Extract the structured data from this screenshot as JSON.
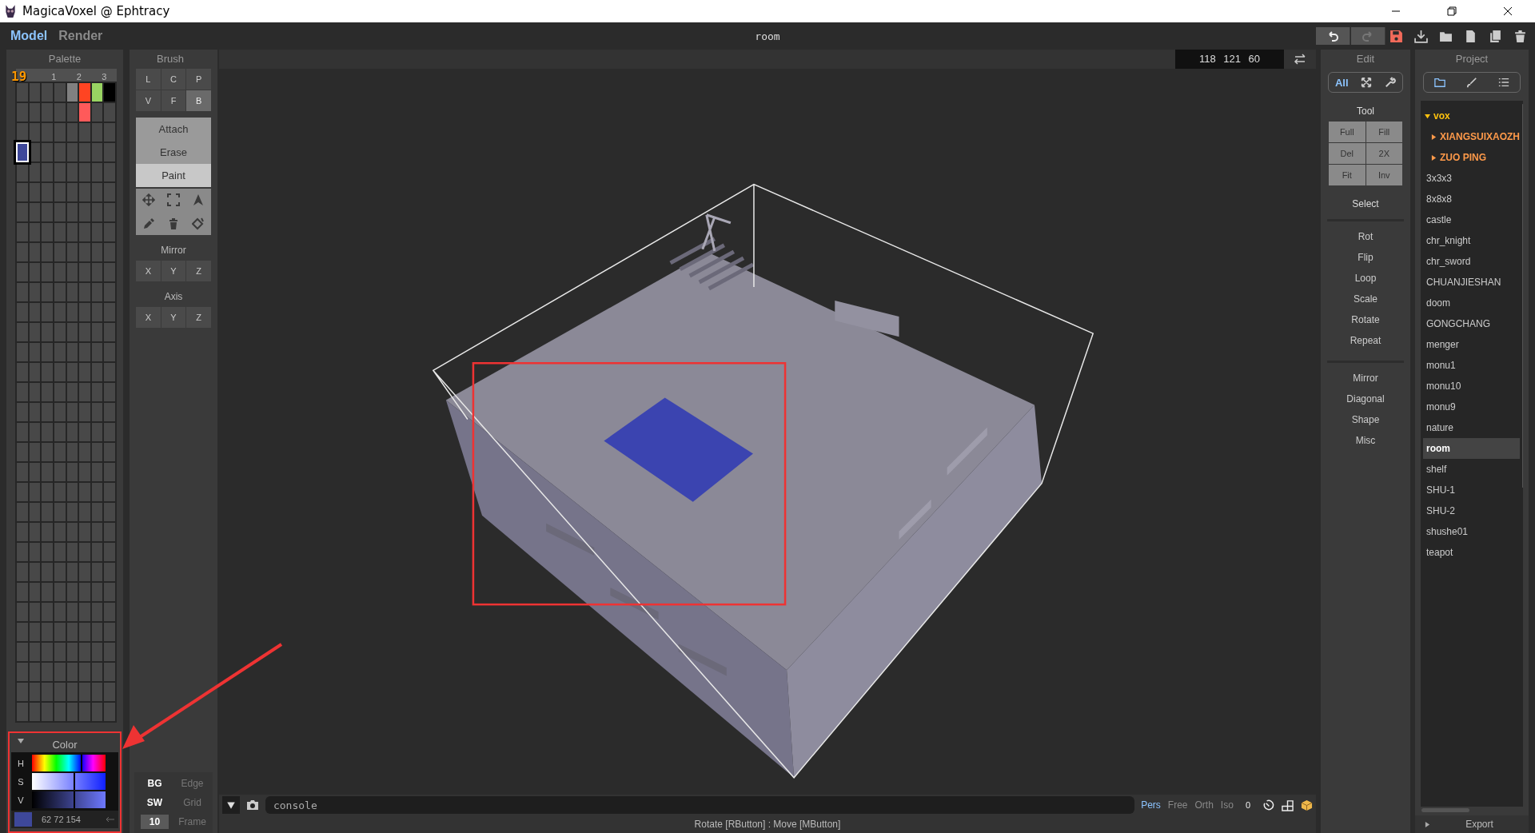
{
  "window": {
    "title": "MagicaVoxel @ Ephtracy"
  },
  "modes": [
    {
      "label": "Model",
      "selected": true
    },
    {
      "label": "Render",
      "selected": false
    }
  ],
  "file_name": "room",
  "toolbar": [
    {
      "kind": "undo",
      "disabled": false
    },
    {
      "kind": "redo",
      "disabled": true
    },
    {
      "kind": "save",
      "disabled": false
    },
    {
      "kind": "export",
      "disabled": false
    },
    {
      "kind": "open",
      "disabled": false
    },
    {
      "kind": "new",
      "disabled": false
    },
    {
      "kind": "copy",
      "disabled": false
    },
    {
      "kind": "delete",
      "disabled": false
    }
  ],
  "palette": {
    "title": "Palette",
    "index_label": "19",
    "column_headers": [
      "1",
      "2",
      "3"
    ],
    "swatches": [
      {
        "color": "#808080",
        "selected": false
      },
      {
        "color": "#ff4422",
        "selected": false
      },
      {
        "color": "#99d462",
        "selected": false
      },
      {
        "color": "#000000",
        "selected": false
      },
      {
        "color": "#ff5a5a",
        "selected": false
      },
      {
        "color": "#3e489a",
        "selected": true
      }
    ]
  },
  "color": {
    "title": "Color",
    "expanded": true,
    "channels": [
      {
        "label": "H",
        "level": 0.66
      },
      {
        "label": "S",
        "level": 0.56
      },
      {
        "label": "V",
        "level": 0.56
      }
    ],
    "color": "#3e489a",
    "rgb": "62 72 154"
  },
  "brush": {
    "title": "Brush",
    "shapes": [
      {
        "label": "L",
        "selected": false
      },
      {
        "label": "C",
        "selected": false
      },
      {
        "label": "P",
        "selected": false
      },
      {
        "label": "V",
        "selected": false
      },
      {
        "label": "F",
        "selected": false
      },
      {
        "label": "B",
        "selected": true
      }
    ],
    "actions": [
      {
        "label": "Attach",
        "selected": false
      },
      {
        "label": "Erase",
        "selected": false
      },
      {
        "label": "Paint",
        "selected": true
      }
    ],
    "tools": [
      {
        "kind": "move"
      },
      {
        "kind": "box"
      },
      {
        "kind": "cursor"
      },
      {
        "kind": "picker"
      },
      {
        "kind": "trash"
      },
      {
        "kind": "bucket"
      }
    ],
    "mirror": {
      "title": "Mirror",
      "axes": [
        "X",
        "Y",
        "Z"
      ]
    },
    "axis": {
      "title": "Axis",
      "axes": [
        "X",
        "Y",
        "Z"
      ]
    },
    "display": [
      {
        "kind": "toggle",
        "label": "BG",
        "on": true
      },
      {
        "kind": "toggle",
        "label": "Edge",
        "on": false
      },
      {
        "kind": "toggle",
        "label": "SW",
        "on": true
      },
      {
        "kind": "toggle",
        "label": "Grid",
        "on": false
      },
      {
        "kind": "field",
        "value": "10"
      },
      {
        "kind": "toggle",
        "label": "Frame",
        "on": false
      }
    ]
  },
  "viewport": {
    "coordinates": "118 121 60",
    "console": {
      "placeholder": "console"
    },
    "view_modes": [
      {
        "label": "Pers",
        "selected": true
      },
      {
        "label": "Free",
        "selected": false
      },
      {
        "label": "Orth",
        "selected": false
      },
      {
        "label": "Iso",
        "selected": false
      }
    ],
    "view_count": "0",
    "status": "Rotate [RButton] : Move [MButton]"
  },
  "edit": {
    "title": "Edit",
    "tabs": [
      {
        "kind": "all",
        "label": "All",
        "selected": true
      },
      {
        "kind": "expand",
        "selected": false
      },
      {
        "kind": "wrench",
        "selected": false
      }
    ],
    "tool_title": "Tool",
    "tool_buttons": [
      "Full",
      "Fill",
      "Del",
      "2X",
      "Fit",
      "Inv"
    ],
    "select_label": "Select",
    "groups": [
      [
        "Rot",
        "Flip",
        "Loop",
        "Scale",
        "Rotate",
        "Repeat"
      ],
      [
        "Mirror",
        "Diagonal",
        "Shape",
        "Misc"
      ]
    ]
  },
  "project": {
    "title": "Project",
    "tabs": [
      {
        "kind": "folder",
        "selected": true
      },
      {
        "kind": "brush",
        "selected": false
      },
      {
        "kind": "list",
        "selected": false
      }
    ],
    "tree": [
      {
        "kind": "folder",
        "label": "vox",
        "expanded": true,
        "children": [
          {
            "kind": "folder",
            "label": "XIANGSUIXAOZH",
            "expanded": false
          },
          {
            "kind": "folder",
            "label": "ZUO PING",
            "expanded": false
          }
        ]
      },
      {
        "kind": "file",
        "label": "3x3x3",
        "selected": false
      },
      {
        "kind": "file",
        "label": "8x8x8",
        "selected": false
      },
      {
        "kind": "file",
        "label": "castle",
        "selected": false
      },
      {
        "kind": "file",
        "label": "chr_knight",
        "selected": false
      },
      {
        "kind": "file",
        "label": "chr_sword",
        "selected": false
      },
      {
        "kind": "file",
        "label": "CHUANJIESHAN",
        "selected": false
      },
      {
        "kind": "file",
        "label": "doom",
        "selected": false
      },
      {
        "kind": "file",
        "label": "GONGCHANG",
        "selected": false
      },
      {
        "kind": "file",
        "label": "menger",
        "selected": false
      },
      {
        "kind": "file",
        "label": "monu1",
        "selected": false
      },
      {
        "kind": "file",
        "label": "monu10",
        "selected": false
      },
      {
        "kind": "file",
        "label": "monu9",
        "selected": false
      },
      {
        "kind": "file",
        "label": "nature",
        "selected": false
      },
      {
        "kind": "file",
        "label": "room",
        "selected": true
      },
      {
        "kind": "file",
        "label": "shelf",
        "selected": false
      },
      {
        "kind": "file",
        "label": "SHU-1",
        "selected": false
      },
      {
        "kind": "file",
        "label": "SHU-2",
        "selected": false
      },
      {
        "kind": "file",
        "label": "shushe01",
        "selected": false
      },
      {
        "kind": "file",
        "label": "teapot",
        "selected": false
      }
    ],
    "export": {
      "label": "Export",
      "expanded": false
    }
  }
}
